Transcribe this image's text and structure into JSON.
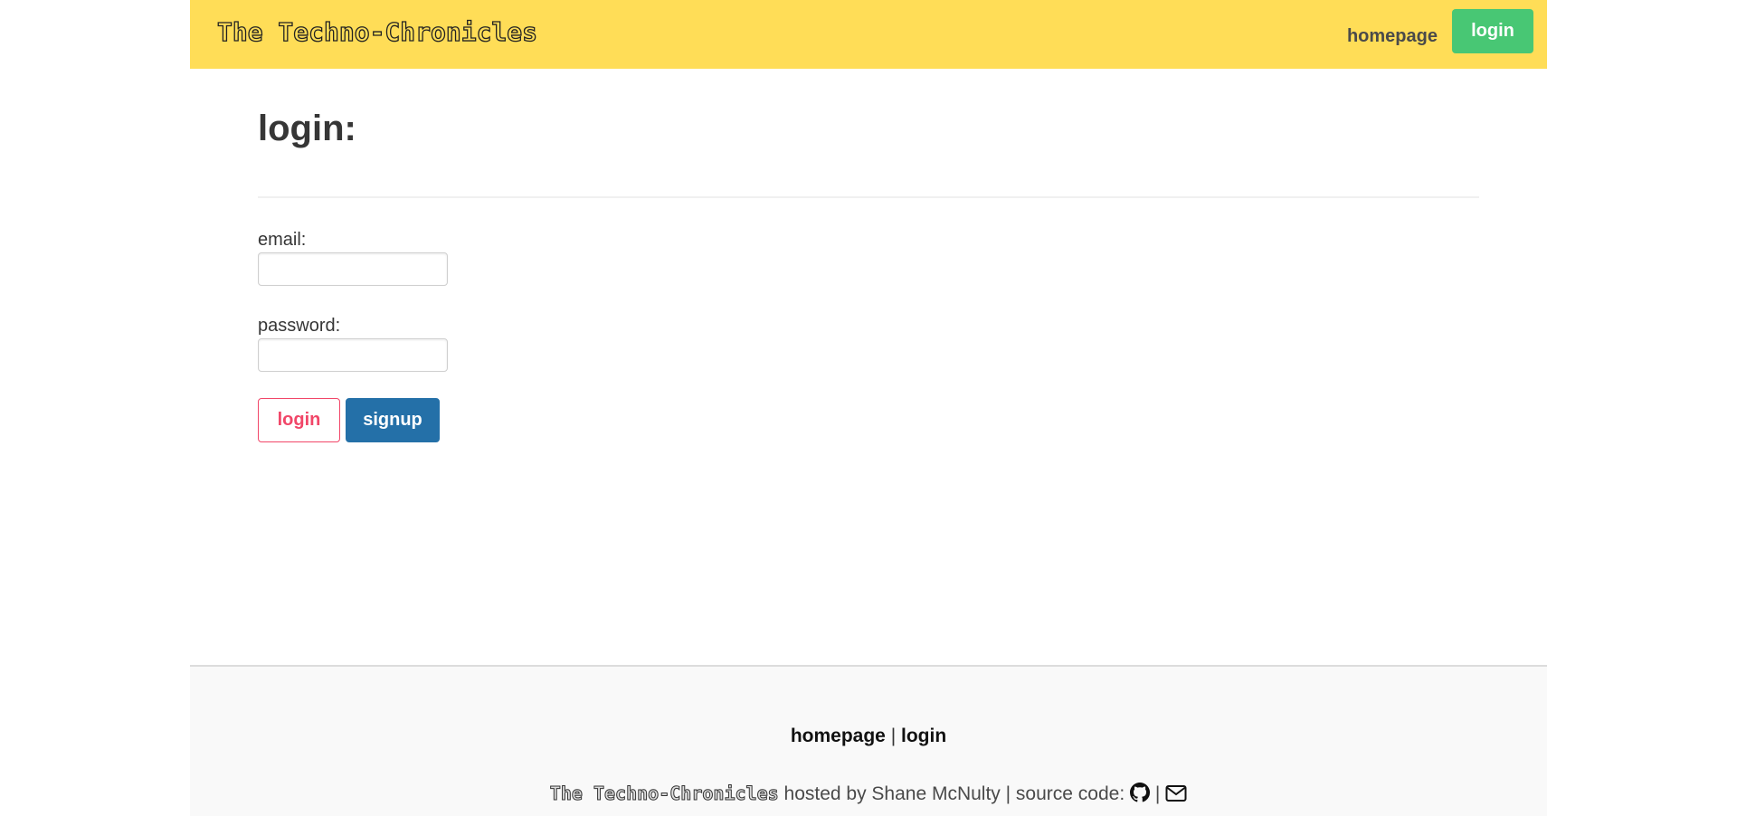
{
  "header": {
    "brand": "The Techno-Chronicles",
    "nav_homepage": "homepage",
    "nav_login": "login"
  },
  "main": {
    "title": "login:",
    "email_label": "email:",
    "email_value": "",
    "password_label": "password:",
    "password_value": "",
    "login_button": "login",
    "signup_button": "signup"
  },
  "footer": {
    "link_homepage": "homepage",
    "separator": "|",
    "link_login": "login",
    "brand": "The Techno-Chronicles",
    "hosted_text": "hosted by Shane McNulty | source code:",
    "icon_separator": "|",
    "github_icon": "github-icon",
    "email_icon": "envelope-icon"
  },
  "colors": {
    "navbar": "#ffdd57",
    "nav_login_bg": "#48c774",
    "login_outline": "#f14668",
    "signup_bg": "#2470a8",
    "footer_bg": "#f9f9f9"
  }
}
